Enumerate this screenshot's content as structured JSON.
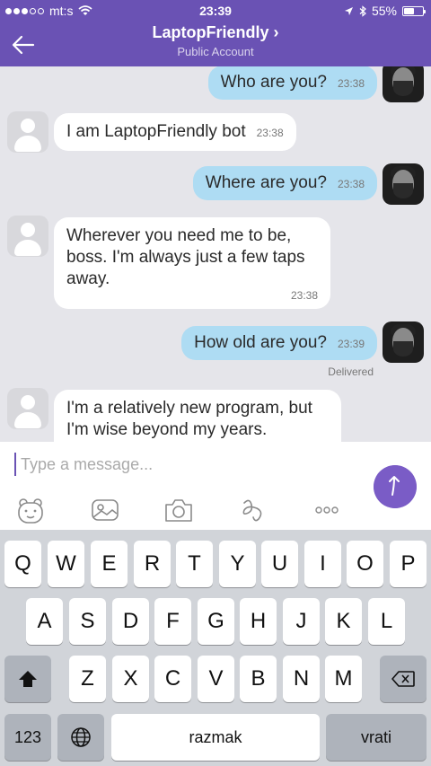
{
  "status_bar": {
    "carrier": "mt:s",
    "time": "23:39",
    "battery": "55%",
    "battery_level": 0.55
  },
  "header": {
    "title": "LaptopFriendly ›",
    "subtitle": "Public Account"
  },
  "messages": [
    {
      "text": "Who are you?",
      "time": "23:38"
    },
    {
      "text": "I am LaptopFriendly bot",
      "time": "23:38"
    },
    {
      "text": "Where are you?",
      "time": "23:38"
    },
    {
      "line1": "Wherever you need me to be,",
      "line2": "boss. I'm always just a few taps",
      "line3": "away.",
      "time": "23:38"
    },
    {
      "text": "How old are you?",
      "time": "23:39",
      "status": "Delivered"
    },
    {
      "line1": "I'm a relatively new program, but",
      "line2": "I'm wise beyond my years."
    }
  ],
  "composer": {
    "placeholder": "Type a message..."
  },
  "keyboard": {
    "row1": [
      "Q",
      "W",
      "E",
      "R",
      "T",
      "Y",
      "U",
      "I",
      "O",
      "P"
    ],
    "row2": [
      "A",
      "S",
      "D",
      "F",
      "G",
      "H",
      "J",
      "K",
      "L"
    ],
    "row3": [
      "Z",
      "X",
      "C",
      "V",
      "B",
      "N",
      "M"
    ],
    "numbers": "123",
    "space": "razmak",
    "return": "vrati"
  },
  "colors": {
    "header": "#6a52b4",
    "outgoing_bubble": "#aedcf3",
    "send_button": "#7a5cc6"
  }
}
